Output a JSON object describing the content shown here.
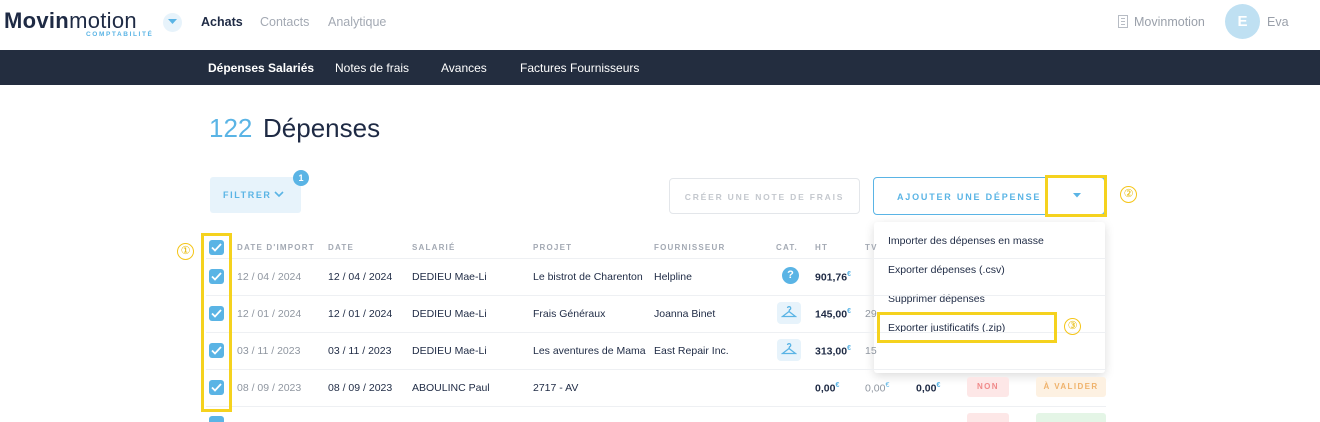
{
  "brand": {
    "name_bold": "Movin",
    "name_light": "motion",
    "subtitle": "COMPTABILITÉ"
  },
  "top_nav": [
    {
      "label": "Achats",
      "active": true
    },
    {
      "label": "Contacts",
      "active": false
    },
    {
      "label": "Analytique",
      "active": false
    }
  ],
  "organization": "Movinmotion",
  "user": {
    "initial": "E",
    "name": "Eva"
  },
  "sub_nav": [
    {
      "label": "Dépenses Salariés",
      "active": true
    },
    {
      "label": "Notes de frais",
      "active": false
    },
    {
      "label": "Avances",
      "active": false
    },
    {
      "label": "Factures Fournisseurs",
      "active": false
    }
  ],
  "page": {
    "count": "122",
    "title": "Dépenses"
  },
  "filter": {
    "label": "FILTRER",
    "badge": "1"
  },
  "actions": {
    "create_note": "CRÉER UNE NOTE DE FRAIS",
    "add_expense": "AJOUTER UNE DÉPENSE"
  },
  "dropdown": [
    "Importer des dépenses en masse",
    "Exporter dépenses (.csv)",
    "Supprimer dépenses",
    "Exporter justificatifs (.zip)"
  ],
  "annotations": [
    "①",
    "②",
    "③"
  ],
  "table": {
    "headers": [
      "DATE D'IMPORT",
      "DATE",
      "SALARIÉ",
      "PROJET",
      "FOURNISSEUR",
      "CAT.",
      "HT",
      "TV"
    ],
    "rows": [
      {
        "import_date": "12 / 04 / 2024",
        "date": "12 / 04 / 2024",
        "employee": "DEDIEU Mae-Li",
        "project": "Le bistrot de Charenton",
        "supplier": "Helpline",
        "category": "help-icon",
        "ht": "901,76",
        "tva": ""
      },
      {
        "import_date": "12 / 01 / 2024",
        "date": "12 / 01 / 2024",
        "employee": "DEDIEU Mae-Li",
        "project": "Frais Généraux",
        "supplier": "Joanna Binet",
        "category": "hanger-icon",
        "ht": "145,00",
        "tva": "29"
      },
      {
        "import_date": "03 / 11 / 2023",
        "date": "03 / 11 / 2023",
        "employee": "DEDIEU Mae-Li",
        "project": "Les aventures de Mama",
        "supplier": "East Repair Inc.",
        "category": "hanger-icon",
        "ht": "313,00",
        "tva": "15"
      },
      {
        "import_date": "08 / 09 / 2023",
        "date": "08 / 09 / 2023",
        "employee": "ABOULINC Paul",
        "project": "2717 - AV",
        "supplier": "",
        "category": "",
        "ht": "0,00",
        "tva": "0,00",
        "ttc": "0,00",
        "receipt": "NON",
        "status": "À VALIDER"
      }
    ]
  },
  "currency": "€",
  "colors": {
    "accent": "#5ab4e5",
    "navy": "#232d3f",
    "highlight": "#f5d21e"
  }
}
